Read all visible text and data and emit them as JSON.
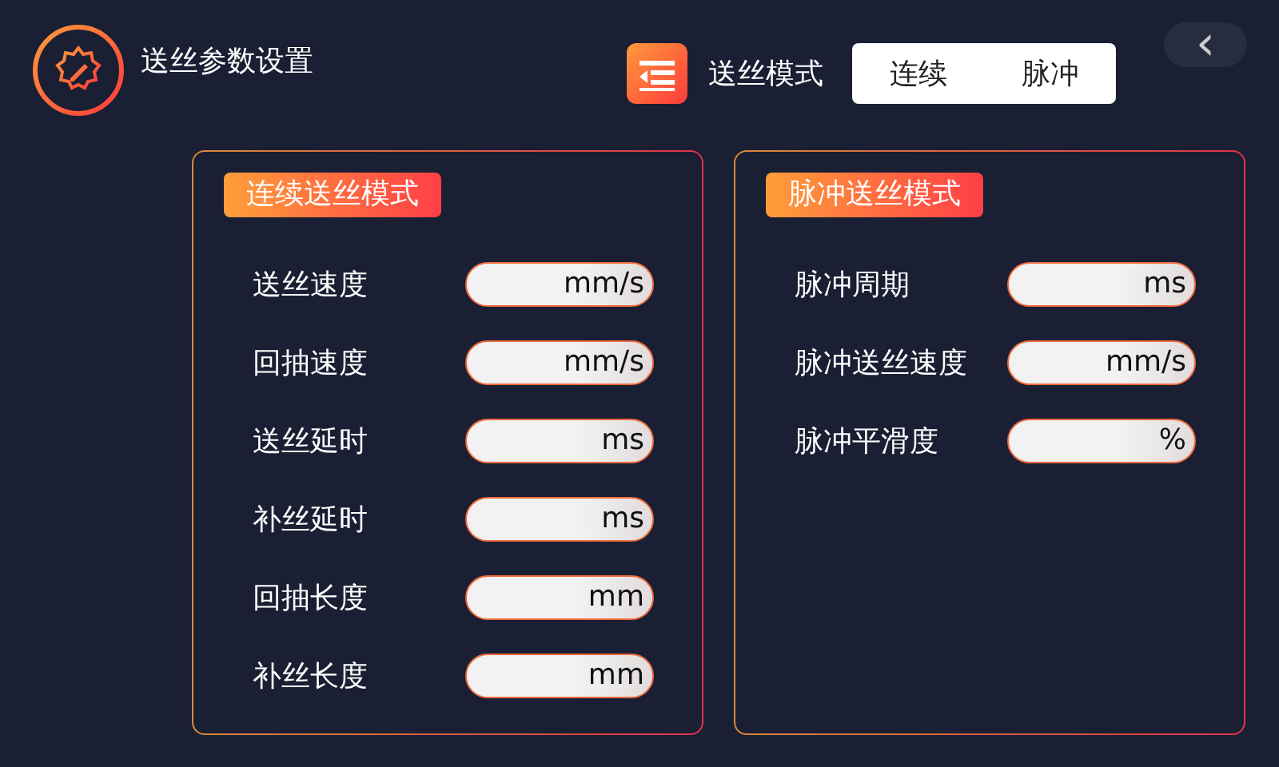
{
  "header": {
    "title": "送丝参数设置",
    "mode_label": "送丝模式",
    "mode_options": [
      "连续",
      "脉冲"
    ],
    "back": "‹"
  },
  "panels": [
    {
      "title": "连续送丝模式",
      "rows": [
        {
          "label": "送丝速度",
          "unit": "mm/s"
        },
        {
          "label": "回抽速度",
          "unit": "mm/s"
        },
        {
          "label": "送丝延时",
          "unit": "ms"
        },
        {
          "label": "补丝延时",
          "unit": "ms"
        },
        {
          "label": "回抽长度",
          "unit": "mm"
        },
        {
          "label": "补丝长度",
          "unit": "mm"
        }
      ]
    },
    {
      "title": "脉冲送丝模式",
      "rows": [
        {
          "label": "脉冲周期",
          "unit": "ms"
        },
        {
          "label": "脉冲送丝速度",
          "unit": "mm/s"
        },
        {
          "label": "脉冲平滑度",
          "unit": "%"
        }
      ]
    }
  ]
}
